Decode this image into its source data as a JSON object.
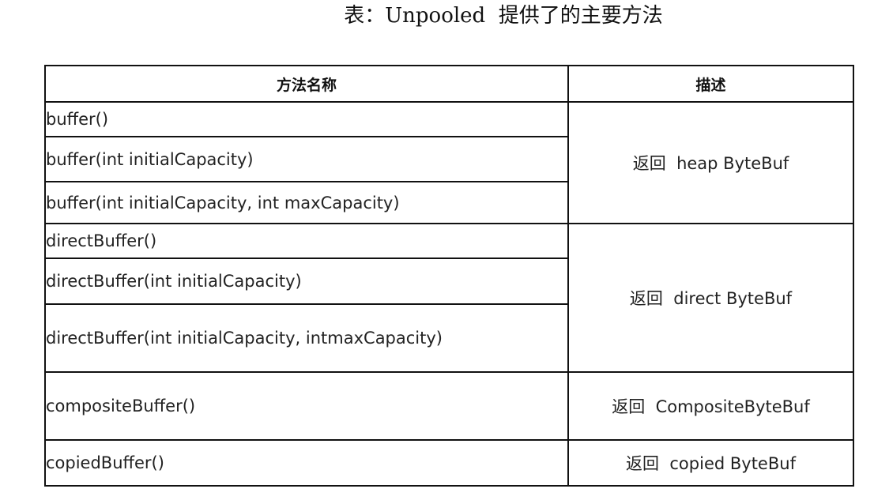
{
  "caption": "表：Unpooled  提供了的主要方法",
  "table": {
    "headers": [
      "方法名称",
      "描述"
    ],
    "groups": [
      {
        "description": "返回  heap ByteBuf",
        "methods": [
          "buffer()",
          "buffer(int initialCapacity)",
          "buffer(int initialCapacity, int maxCapacity)"
        ]
      },
      {
        "description": "返回  direct ByteBuf",
        "methods": [
          "directBuffer()",
          "directBuffer(int initialCapacity)",
          "directBuffer(int initialCapacity, intmaxCapacity)"
        ]
      },
      {
        "description": "返回  CompositeByteBuf",
        "methods": [
          "compositeBuffer()"
        ]
      },
      {
        "description": "返回  copied ByteBuf",
        "methods": [
          "copiedBuffer()"
        ]
      }
    ]
  }
}
